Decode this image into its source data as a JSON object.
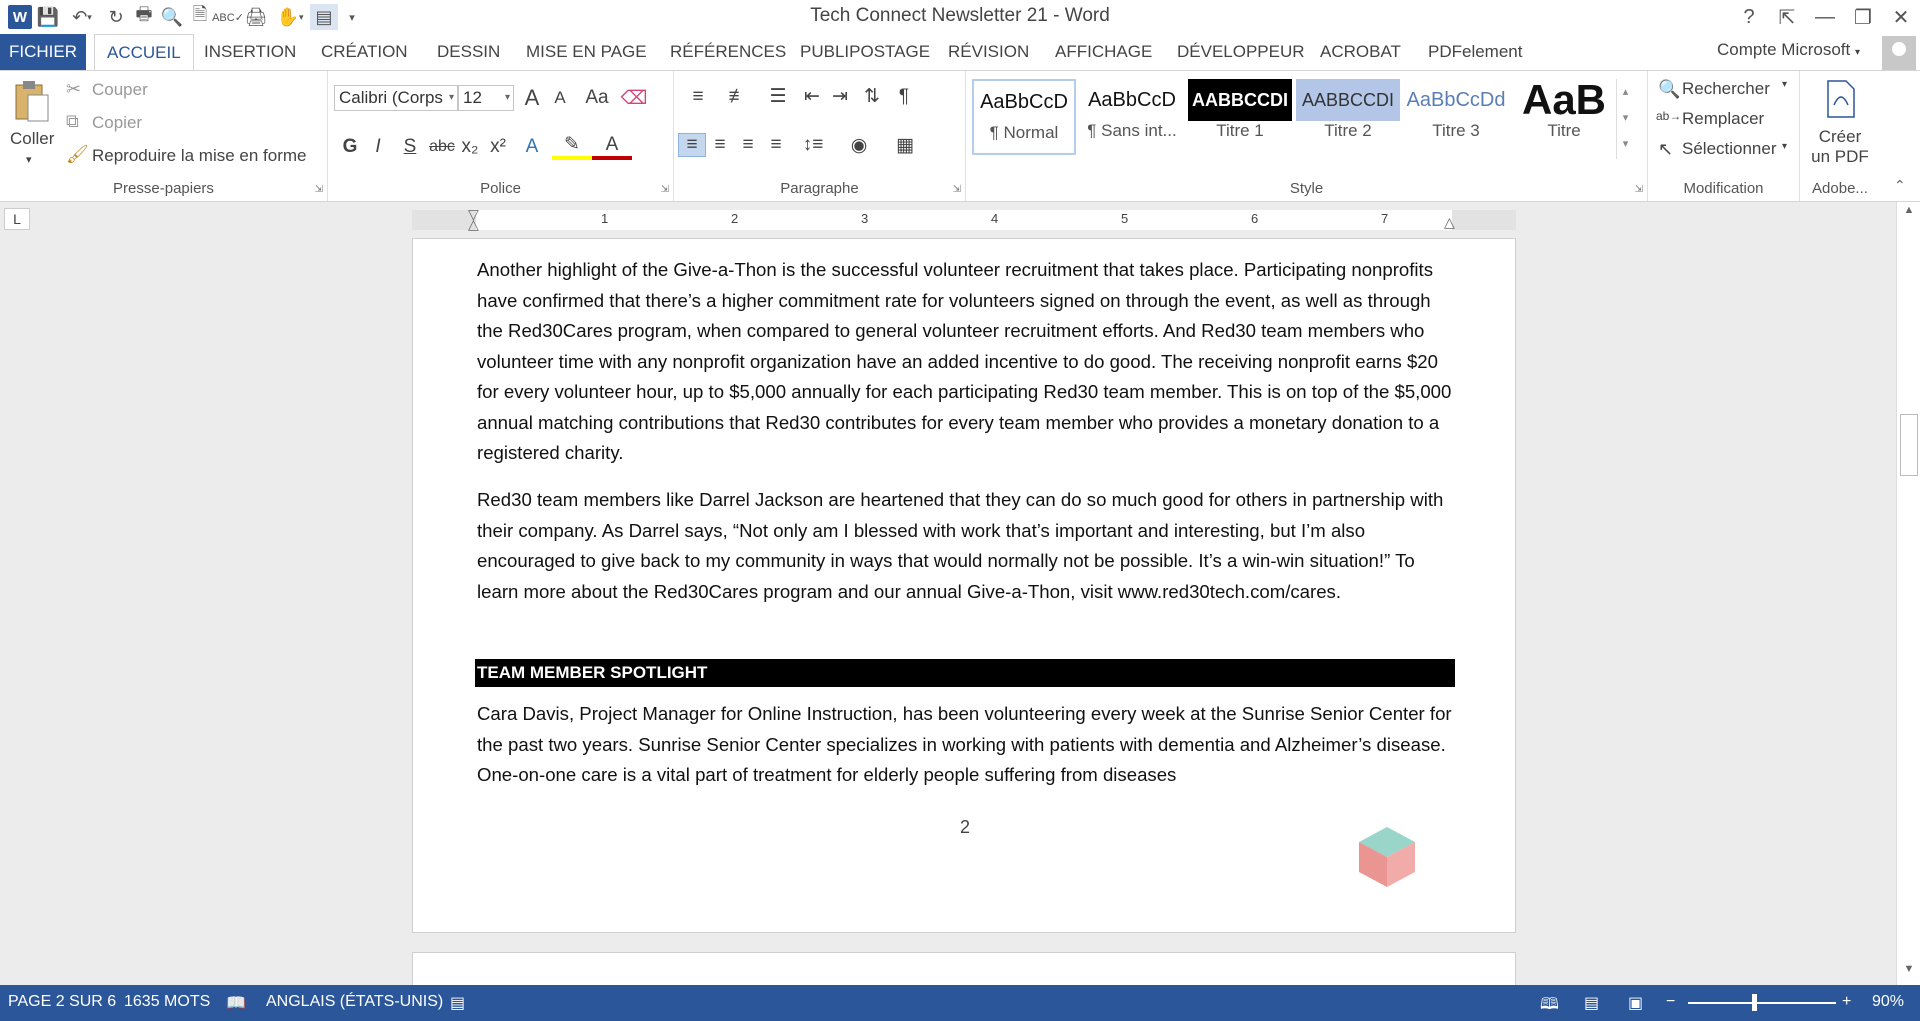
{
  "window": {
    "title": "Tech Connect Newsletter 21 - Word",
    "controls": [
      "?",
      "⇱",
      "—",
      "❐",
      "✕"
    ]
  },
  "qat": {
    "app_icon": "W",
    "icons": [
      "save-icon",
      "undo-icon",
      "redo-icon",
      "print-icon",
      "preview-icon",
      "new-doc-icon",
      "spelling-icon",
      "quick-print-icon",
      "touch-mode-icon",
      "layout-icon"
    ]
  },
  "tabs": {
    "file": "FICHIER",
    "items": [
      "ACCUEIL",
      "INSERTION",
      "CRÉATION",
      "DESSIN",
      "MISE EN PAGE",
      "RÉFÉRENCES",
      "PUBLIPOSTAGE",
      "RÉVISION",
      "AFFICHAGE",
      "DÉVELOPPEUR",
      "ACROBAT",
      "PDFelement"
    ],
    "active": "ACCUEIL",
    "account": "Compte Microsoft"
  },
  "ribbon": {
    "clipboard": {
      "label": "Presse-papiers",
      "paste": "Coller",
      "cut": "Couper",
      "copy": "Copier",
      "format_painter": "Reproduire la mise en forme"
    },
    "font": {
      "label": "Police",
      "font_name": "Calibri (Corps",
      "font_size": "12",
      "bold": "G",
      "italic": "I",
      "underline": "S",
      "strikethrough": "abc",
      "subscript": "x₂",
      "superscript": "x²",
      "grow": "A",
      "shrink": "A",
      "case": "Aa",
      "highlight_color": "#ffff00",
      "font_color": "#c00000"
    },
    "paragraph": {
      "label": "Paragraphe"
    },
    "styles": {
      "label": "Style",
      "items": [
        {
          "preview": "AaBbCcD",
          "name": "¶ Normal"
        },
        {
          "preview": "AaBbCcD",
          "name": "¶ Sans int..."
        },
        {
          "preview": "AABBCCDI",
          "name": "Titre 1"
        },
        {
          "preview": "AABBCCDI",
          "name": "Titre 2"
        },
        {
          "preview": "AaBbCcDd",
          "name": "Titre 3"
        },
        {
          "preview": "AaB",
          "name": "Titre"
        }
      ]
    },
    "editing": {
      "label": "Modification",
      "find": "Rechercher",
      "replace": "Remplacer",
      "select": "Sélectionner"
    },
    "adobe": {
      "label": "Adobe...",
      "create_pdf_line1": "Créer",
      "create_pdf_line2": "un PDF"
    }
  },
  "ruler": {
    "numbers": [
      "1",
      "2",
      "3",
      "4",
      "5",
      "6",
      "7"
    ],
    "tab_selector": "L"
  },
  "document": {
    "paragraphs": [
      "Another highlight of the Give-a-Thon is the successful volunteer recruitment that takes place. Participating nonprofits have confirmed that there’s a higher commitment rate for volunteers signed on through the event, as well as through the Red30Cares program, when compared to general volunteer recruitment efforts. And Red30 team members who volunteer time with any nonprofit organization have an added incentive to do good. The receiving nonprofit earns $20 for every volunteer hour, up to $5,000 annually for each participating Red30 team member. This is on top of the $5,000 annual matching contributions that Red30 contributes for every team member who provides a monetary donation to a registered charity.",
      "Red30 team members like Darrel Jackson are heartened that they can do so much good for others in partnership with their company. As Darrel says, “Not only am I blessed with work that’s important and interesting, but I’m also encouraged to give back to my community in ways that would normally not be possible. It’s a win-win situation!” To learn more about the Red30Cares program and our annual Give-a-Thon, visit www.red30tech.com/cares.",
      "Cara Davis, Project Manager for Online Instruction, has been volunteering every week at the Sunrise Senior Center for the past two years. Sunrise Senior Center specializes in working with patients with dementia and Alzheimer’s disease. One-on-one care is a vital part of treatment for elderly people suffering from diseases"
    ],
    "heading": "TEAM MEMBER SPOTLIGHT",
    "page_number": "2"
  },
  "statusbar": {
    "page": "PAGE 2 SUR 6",
    "words": "1635 MOTS",
    "language": "ANGLAIS (ÉTATS-UNIS)",
    "zoom": "90%",
    "zoom_minus": "−",
    "zoom_plus": "+"
  }
}
